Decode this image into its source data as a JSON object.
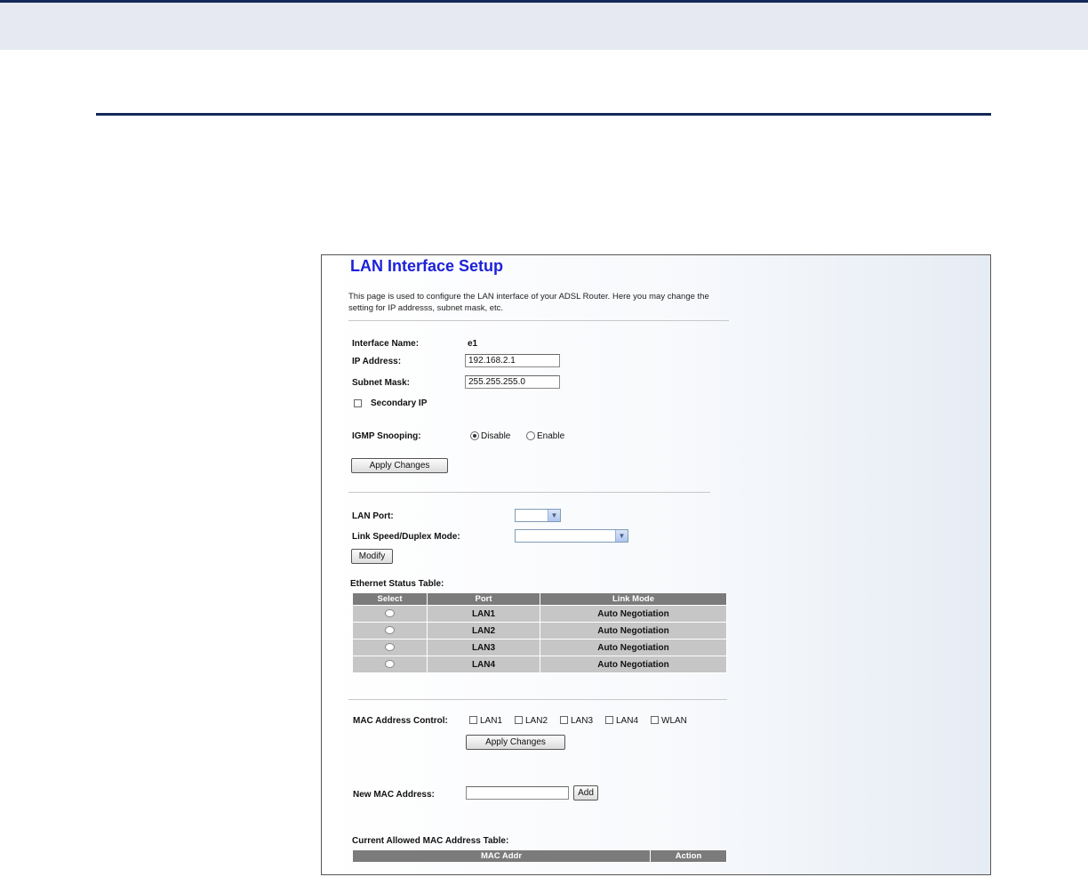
{
  "page": {
    "title": "LAN Interface Setup",
    "description": "This page is used to configure the LAN interface of your ADSL Router. Here you may change the setting for IP addresss, subnet mask, etc."
  },
  "interface": {
    "name_label": "Interface Name:",
    "name_value": "e1",
    "ip_label": "IP Address:",
    "ip_value": "192.168.2.1",
    "mask_label": "Subnet Mask:",
    "mask_value": "255.255.255.0",
    "secondary_ip_label": "Secondary IP",
    "secondary_ip_checked": false
  },
  "igmp": {
    "label": "IGMP Snooping:",
    "options": [
      "Disable",
      "Enable"
    ],
    "selected": "Disable"
  },
  "buttons": {
    "apply_changes": "Apply Changes",
    "modify": "Modify",
    "add": "Add"
  },
  "lan_port": {
    "port_label": "LAN Port:",
    "port_value": "",
    "speed_label": "Link Speed/Duplex Mode:",
    "speed_value": ""
  },
  "ethernet_table": {
    "caption": "Ethernet Status Table:",
    "headers": [
      "Select",
      "Port",
      "Link Mode"
    ],
    "rows": [
      {
        "port": "LAN1",
        "mode": "Auto Negotiation"
      },
      {
        "port": "LAN2",
        "mode": "Auto Negotiation"
      },
      {
        "port": "LAN3",
        "mode": "Auto Negotiation"
      },
      {
        "port": "LAN4",
        "mode": "Auto Negotiation"
      }
    ]
  },
  "mac_control": {
    "label": "MAC Address Control:",
    "options": [
      "LAN1",
      "LAN2",
      "LAN3",
      "LAN4",
      "WLAN"
    ]
  },
  "new_mac": {
    "label": "New MAC Address:",
    "value": ""
  },
  "mac_table": {
    "caption": "Current Allowed MAC Address Table:",
    "headers": [
      "MAC Addr",
      "Action"
    ]
  }
}
